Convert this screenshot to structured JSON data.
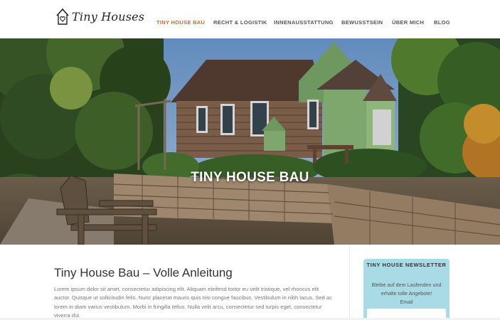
{
  "brand": {
    "name": "Tiny Houses"
  },
  "nav": {
    "items": [
      {
        "label": "TINY HOUSE BAU",
        "active": true
      },
      {
        "label": "RECHT & LOGISTIK"
      },
      {
        "label": "INNENAUSSTATTUNG"
      },
      {
        "label": "BEWUSSTSEIN"
      },
      {
        "label": "ÜBER MICH"
      },
      {
        "label": "BLOG"
      }
    ],
    "active_color": "#e0652f"
  },
  "hero": {
    "title": "TINY HOUSE BAU"
  },
  "post": {
    "title": "Tiny House Bau – Volle Anleitung",
    "body": "Lorem ipsum dolor sit amet, consectetur adipiscing elit. Aliquam eleifend tortor eu velit tristique, vel rhoncus elit auctor. Quisque ut sollicitudin felis. Nunc placerat mauris quis nisi congue faucibus. Vestibulum in nibh lacus. Sed ac lorem in diam varius vestibulum. Morbi in fringilla tellus. Nulla velit arcu, consectetur sed turpis eget, consectetur viverra dui."
  },
  "newsletter": {
    "title": "TINY HOUSE NEWSLETTER",
    "text": "Bleibe auf dem Laufenden und erhalte tolle Angebote!",
    "email_label": "Email",
    "email_value": "",
    "background": "#a9dbe6"
  },
  "icons": {
    "logo": "house-heart-icon"
  }
}
